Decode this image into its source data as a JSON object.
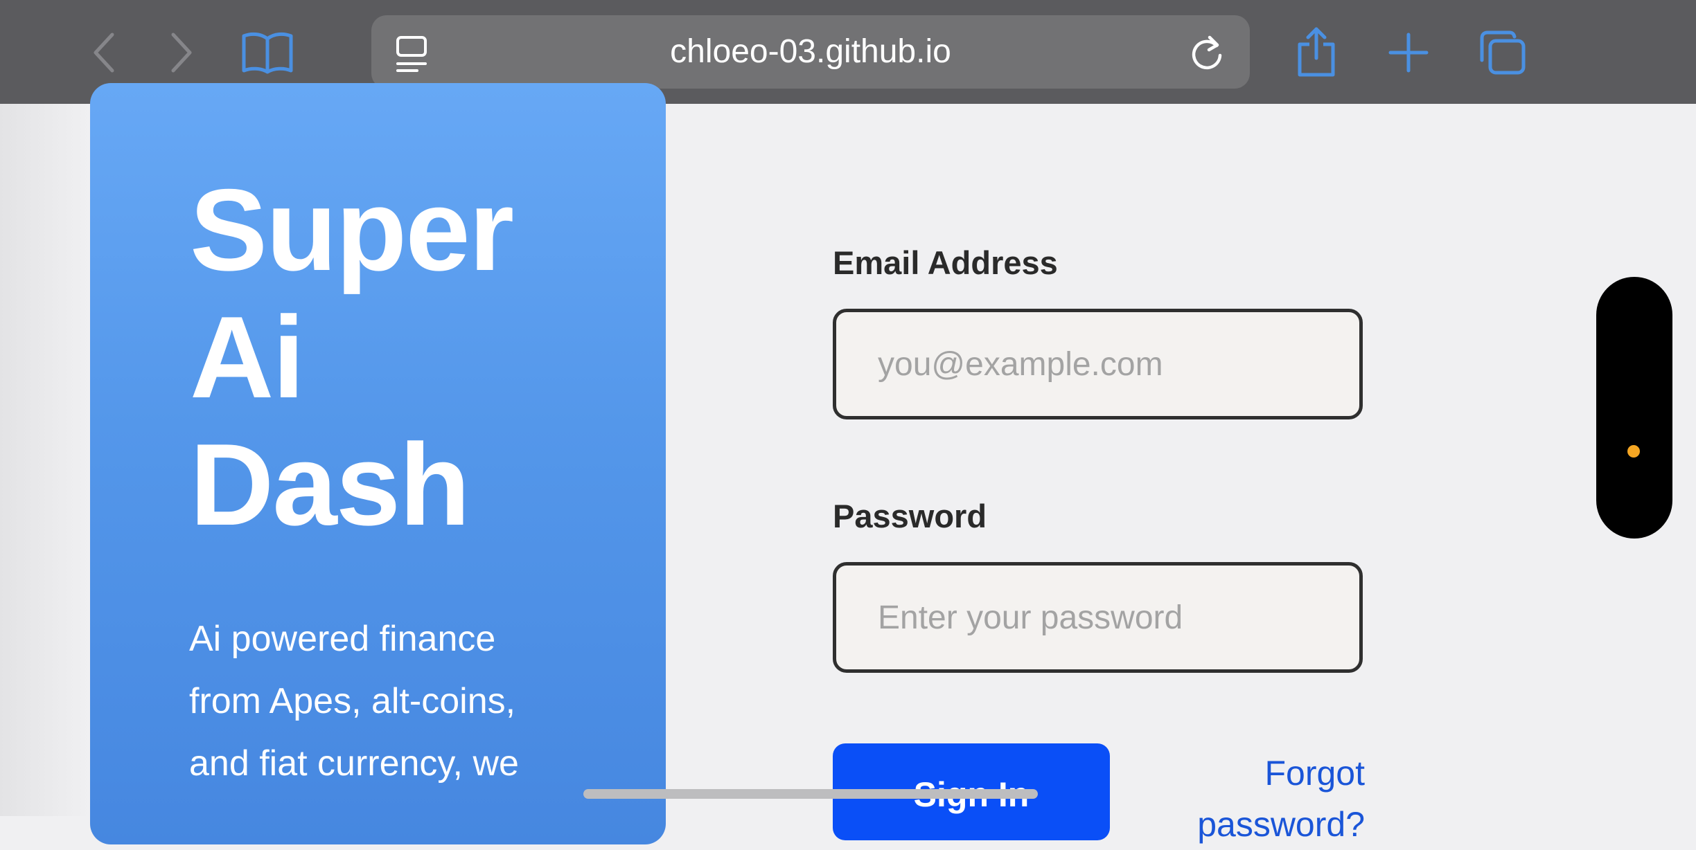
{
  "browser": {
    "url": "chloeo-03.github.io",
    "icons": {
      "back": "chevron-left-icon",
      "forward": "chevron-right-icon",
      "bookmarks": "book-icon",
      "reader": "reader-mode-icon",
      "reload": "reload-icon",
      "share": "share-icon",
      "new_tab": "plus-icon",
      "tabs": "tabs-icon"
    },
    "colors": {
      "toolbar": "#5b5b5e",
      "accent": "#4a90e2"
    }
  },
  "hero": {
    "title_lines": [
      "Super",
      "Ai",
      "Dash"
    ],
    "description": "Ai powered finance from Apes, alt-coins, and fiat currency, we"
  },
  "form": {
    "email_label": "Email Address",
    "email_placeholder": "you@example.com",
    "email_value": "",
    "password_label": "Password",
    "password_placeholder": "Enter your password",
    "password_value": "",
    "signin_label": "Sign In",
    "forgot_label": "Forgot password?",
    "colors": {
      "primary_button": "#0a4ff7",
      "link": "#1a55d8"
    }
  }
}
